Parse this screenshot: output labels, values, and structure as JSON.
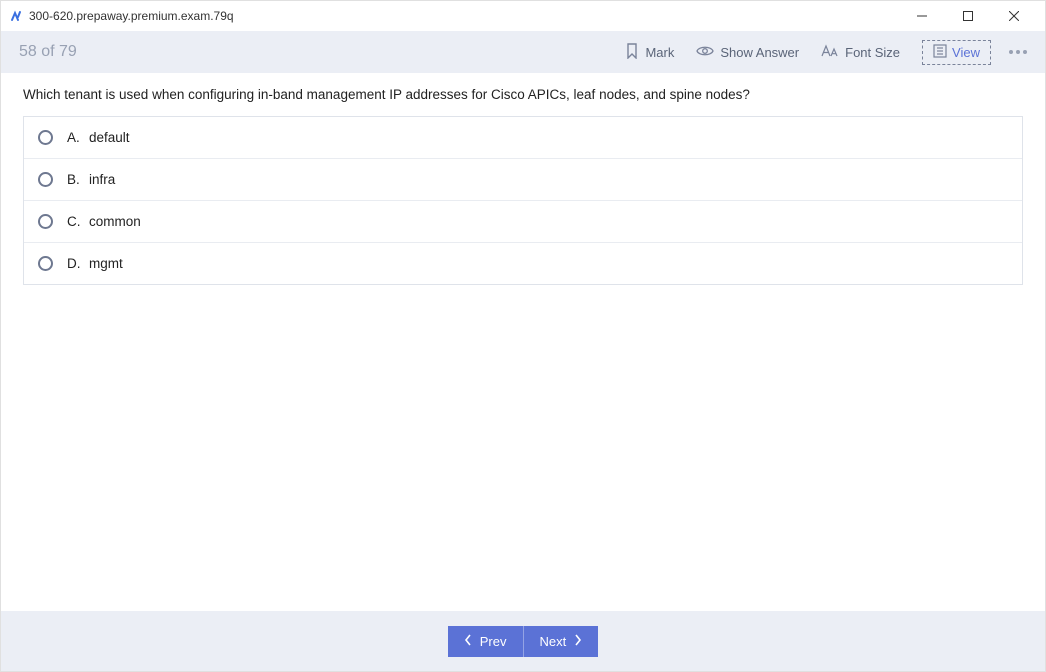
{
  "window": {
    "title": "300-620.prepaway.premium.exam.79q"
  },
  "toolbar": {
    "progress": "58 of 79",
    "mark_label": "Mark",
    "show_answer_label": "Show Answer",
    "font_size_label": "Font Size",
    "view_label": "View"
  },
  "question": {
    "text": "Which tenant is used when configuring in-band management IP addresses for Cisco APICs, leaf nodes, and spine nodes?",
    "answers": [
      {
        "letter": "A.",
        "text": "default"
      },
      {
        "letter": "B.",
        "text": "infra"
      },
      {
        "letter": "C.",
        "text": "common"
      },
      {
        "letter": "D.",
        "text": "mgmt"
      }
    ]
  },
  "footer": {
    "prev_label": "Prev",
    "next_label": "Next"
  }
}
